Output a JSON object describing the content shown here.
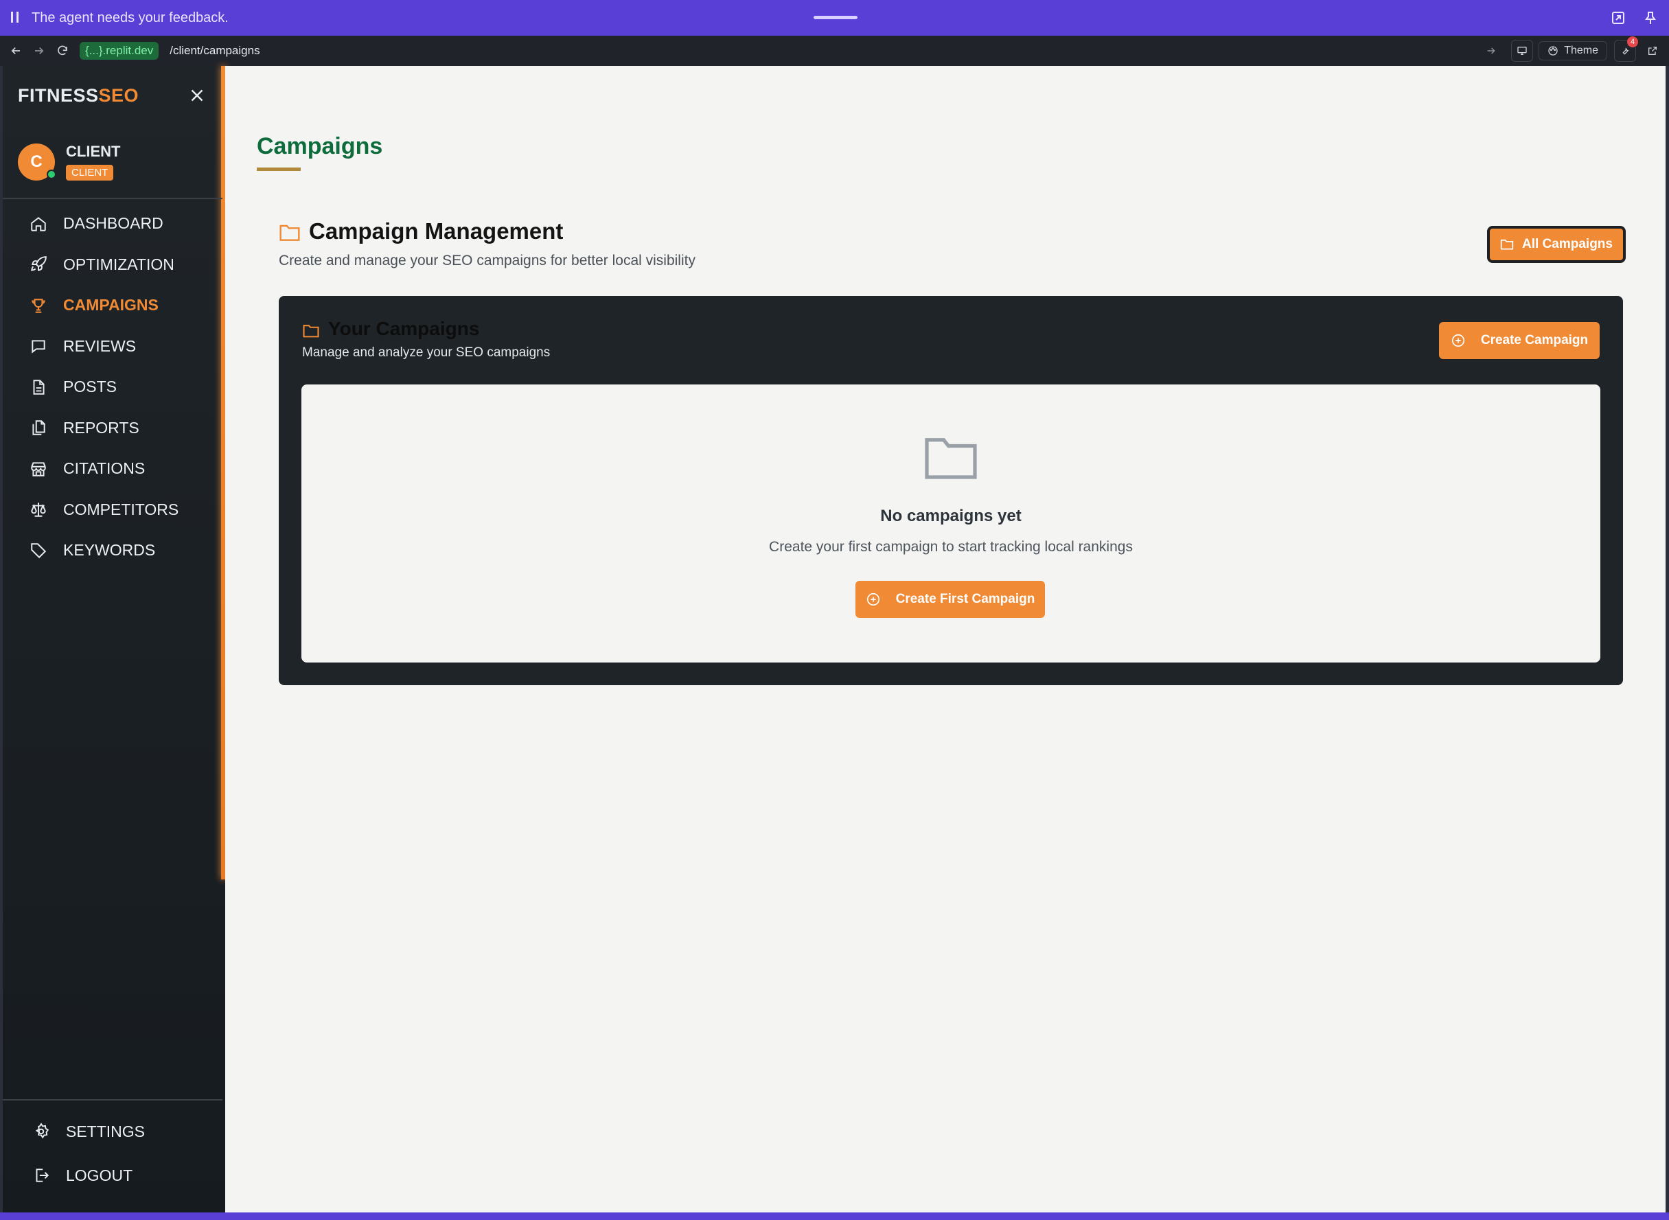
{
  "agent_bar": {
    "message": "The agent needs your feedback."
  },
  "browser": {
    "url_host": "{...}.replit.dev",
    "url_path": "/client/campaigns",
    "theme_label": "Theme",
    "notification_count": "4"
  },
  "sidebar": {
    "logo_part1": "FITNESS",
    "logo_part2": "SEO",
    "user": {
      "initial": "C",
      "name": "CLIENT",
      "role": "CLIENT"
    },
    "items": [
      {
        "label": "DASHBOARD",
        "icon": "home-icon"
      },
      {
        "label": "OPTIMIZATION",
        "icon": "rocket-icon"
      },
      {
        "label": "CAMPAIGNS",
        "icon": "trophy-icon",
        "active": true
      },
      {
        "label": "REVIEWS",
        "icon": "message-icon"
      },
      {
        "label": "POSTS",
        "icon": "file-icon"
      },
      {
        "label": "REPORTS",
        "icon": "files-icon"
      },
      {
        "label": "CITATIONS",
        "icon": "store-icon"
      },
      {
        "label": "COMPETITORS",
        "icon": "scale-icon"
      },
      {
        "label": "KEYWORDS",
        "icon": "tag-icon"
      }
    ],
    "bottom_items": [
      {
        "label": "SETTINGS",
        "icon": "gear-icon"
      },
      {
        "label": "LOGOUT",
        "icon": "logout-icon"
      }
    ]
  },
  "main": {
    "page_title": "Campaigns",
    "management": {
      "title": "Campaign Management",
      "subtitle": "Create and manage your SEO campaigns for better local visibility",
      "all_campaigns_label": "All Campaigns"
    },
    "your_campaigns": {
      "title": "Your Campaigns",
      "subtitle": "Manage and analyze your SEO campaigns",
      "create_label": "Create Campaign"
    },
    "empty_state": {
      "title": "No campaigns yet",
      "subtitle": "Create your first campaign to start tracking local rankings",
      "button_label": "Create First Campaign"
    }
  },
  "colors": {
    "accent": "#f08a35",
    "page_title": "#0e6b3b",
    "agent_bar": "#5a3fd6",
    "sidebar_bg": "#1f2428",
    "panel_bg": "#1e2427"
  }
}
